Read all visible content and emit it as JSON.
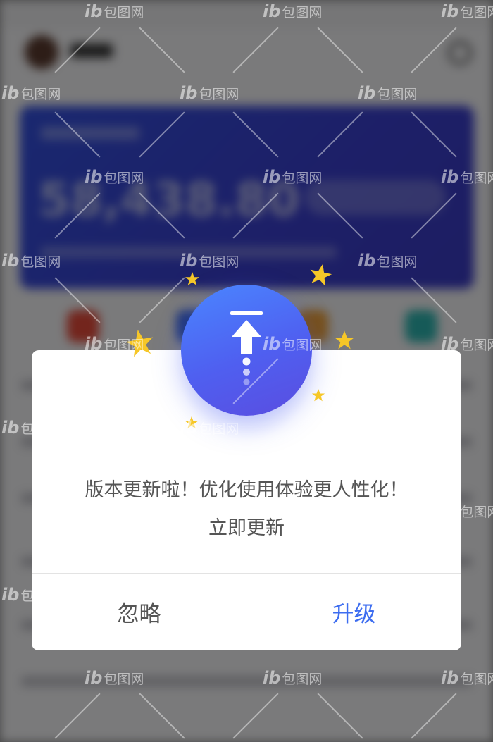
{
  "dialog": {
    "message_line1": "版本更新啦！优化使用体验更人性化！",
    "message_line2": "立即更新",
    "ignore_label": "忽略",
    "upgrade_label": "升级"
  },
  "background": {
    "amount": "58,438.80"
  },
  "watermark": {
    "text": "包图网",
    "logo": "ib"
  },
  "colors": {
    "accent": "#3d6df0",
    "circle_start": "#4a86ff",
    "circle_end": "#5a4de0",
    "star": "#f6c728",
    "overlay": "rgba(0,0,0,0.5)",
    "card": "#3350e0"
  },
  "icons": {
    "upgrade": "upload-arrow-icon",
    "stars": "star-icon"
  }
}
